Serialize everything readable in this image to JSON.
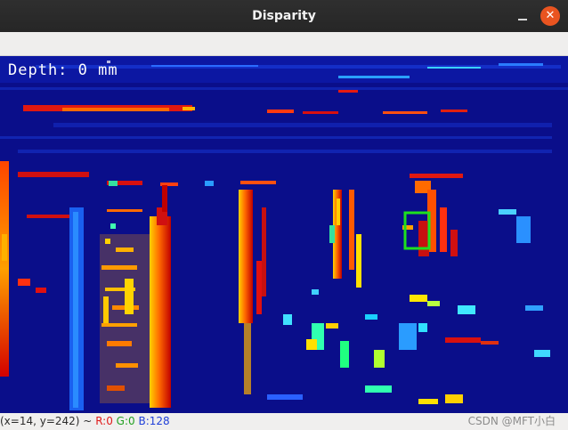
{
  "window": {
    "title": "Disparity",
    "minimize_icon": "minimize-icon",
    "close_icon": "close-icon",
    "close_glyph": "✕"
  },
  "overlay": {
    "depth_text": "Depth: 0 mm",
    "selection_color": "#1ee01e"
  },
  "status": {
    "coords": "(x=14, y=242) ~",
    "r": "R:0",
    "g": "G:0",
    "b": "B:128",
    "watermark": "CSDN @MFT小白"
  },
  "colors": {
    "background": "#0a0e8a",
    "accent_close": "#e95420"
  }
}
